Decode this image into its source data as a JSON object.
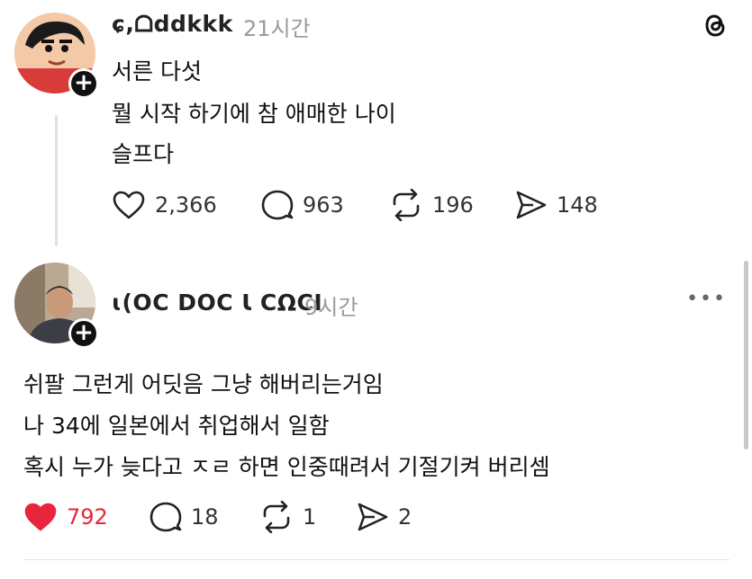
{
  "app": {
    "logo_icon": "threads-logo-icon",
    "accent_like": "#e8253b"
  },
  "posts": [
    {
      "username": "ɕ,ᗝddkkk",
      "time": "21시간",
      "lines": [
        "서른 다섯",
        "뭘 시작 하기에 참 애매한 나이",
        "슬프다"
      ],
      "likes": "2,366",
      "comments": "963",
      "reposts": "196",
      "shares": "148",
      "liked": false
    },
    {
      "username": "ɩ(OC DOC Ɩ CΩCI",
      "time": "9시간",
      "lines": [
        "쉬팔 그런게 어딧음 그냥 해버리는거임",
        "나 34에 일본에서 취업해서 일함",
        "혹시 누가 늦다고 ㅈㄹ 하면 인중때려서 기절기켜 버리셈"
      ],
      "likes": "792",
      "comments": "18",
      "reposts": "1",
      "shares": "2",
      "liked": true
    }
  ]
}
